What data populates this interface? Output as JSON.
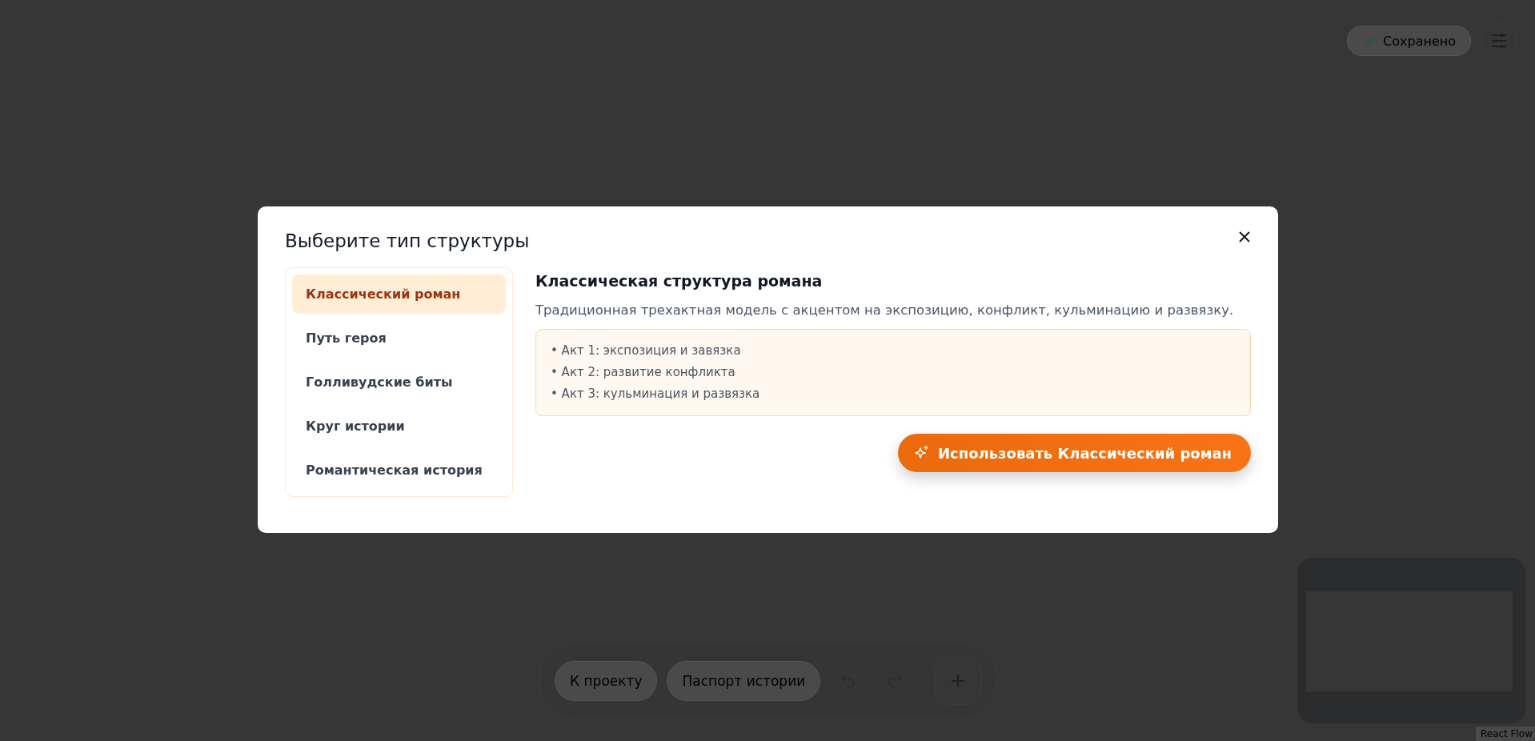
{
  "header": {
    "save_status": "Сохранено"
  },
  "toolbar": {
    "buttons": [
      "К проекту",
      "Паспорт истории"
    ]
  },
  "attribution": "React Flow",
  "dialog": {
    "title": "Выберите тип структуры",
    "structure_types": [
      {
        "label": "Классический роман",
        "selected": true
      },
      {
        "label": "Путь героя",
        "selected": false
      },
      {
        "label": "Голливудские биты",
        "selected": false
      },
      {
        "label": "Круг истории",
        "selected": false
      },
      {
        "label": "Романтическая история",
        "selected": false
      }
    ],
    "detail": {
      "heading": "Классическая структура романа",
      "description": "Традиционная трехактная модель с акцентом на экспозицию, конфликт, кульминацию и развязку.",
      "acts": [
        "• Акт 1: экспозиция и завязка",
        "• Акт 2: развитие конфликта",
        "• Акт 3: кульминация и развязка"
      ]
    },
    "apply_button": "Использовать Классический роман"
  }
}
